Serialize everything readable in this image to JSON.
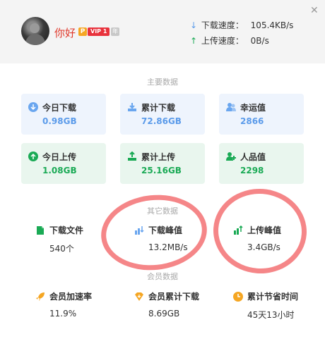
{
  "user": {
    "name": "你好",
    "badge_p": "P",
    "badge_vip": "VIP 1",
    "badge_year": "年"
  },
  "speed": {
    "download_label": "下载速度：",
    "download_value": "105.4KB/s",
    "upload_label": "上传速度：",
    "upload_value": "0B/s"
  },
  "sections": {
    "main": "主要数据",
    "other": "其它数据",
    "member": "会员数据"
  },
  "main_cards": [
    {
      "label": "今日下载",
      "value": "0.98GB",
      "icon": "arrow-down-circle-icon"
    },
    {
      "label": "累计下载",
      "value": "72.86GB",
      "icon": "download-tray-icon"
    },
    {
      "label": "幸运值",
      "value": "2866",
      "icon": "users-icon"
    },
    {
      "label": "今日上传",
      "value": "1.08GB",
      "icon": "arrow-up-circle-icon"
    },
    {
      "label": "累计上传",
      "value": "25.16GB",
      "icon": "upload-tray-icon"
    },
    {
      "label": "人品值",
      "value": "2298",
      "icon": "person-plus-icon"
    }
  ],
  "other_stats": [
    {
      "label": "下载文件",
      "value": "540个",
      "icon": "file-icon"
    },
    {
      "label": "下载峰值",
      "value": "13.2MB/s",
      "icon": "download-peak-icon"
    },
    {
      "label": "上传峰值",
      "value": "3.4GB/s",
      "icon": "upload-peak-icon"
    }
  ],
  "member_stats": [
    {
      "label": "会员加速率",
      "value": "11.9%",
      "icon": "rocket-icon"
    },
    {
      "label": "会员累计下载",
      "value": "8.69GB",
      "icon": "diamond-download-icon"
    },
    {
      "label": "累计节省时间",
      "value": "45天13小时",
      "icon": "clock-icon"
    }
  ],
  "colors": {
    "blue_value": "#5b9bea",
    "green_value": "#1aaa55",
    "name_red": "#e0392b",
    "annotation": "#f47f82",
    "member_orange": "#f5a623"
  }
}
